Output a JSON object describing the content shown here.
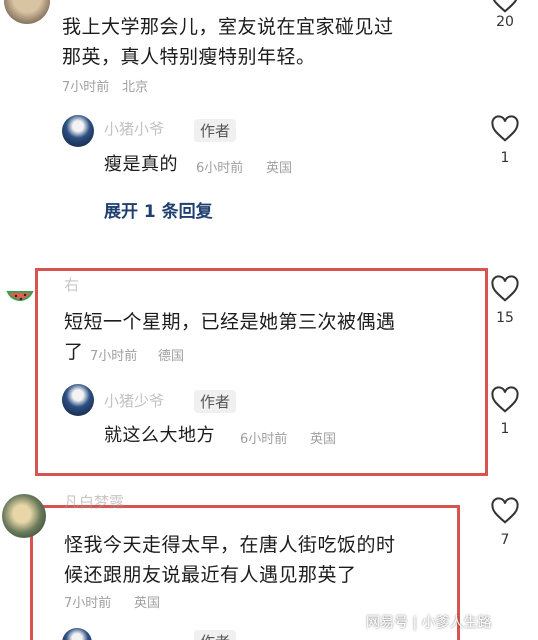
{
  "comments": [
    {
      "text_line1": "我上大学那会儿，室友说在宜家碰见过",
      "text_line2": "那英，真人特别瘦特别年轻。",
      "time": "7小时前",
      "location": "北京",
      "likes": "20",
      "reply": {
        "name": "小猪小爷",
        "badge": "作者",
        "text": "瘦是真的",
        "time": "6小时前",
        "location": "英国",
        "likes": "1"
      },
      "expand_label": "展开 1 条回复"
    },
    {
      "name": "右",
      "text_line1": "短短一个星期，已经是她第三次被偶遇",
      "text_line2": "了",
      "time": "7小时前",
      "location": "德国",
      "likes": "15",
      "reply": {
        "name": "小猪少爷",
        "badge": "作者",
        "text": "就这么大地方",
        "time": "6小时前",
        "location": "英国",
        "likes": "1"
      }
    },
    {
      "name": "凡白梦露",
      "text_line1": "怪我今天走得太早，在唐人街吃饭的时",
      "text_line2": "候还跟朋友说最近有人遇见那英了",
      "time": "7小时前",
      "location": "英国",
      "likes": "7",
      "reply": {
        "badge": "作者"
      }
    }
  ],
  "watermark": "网易号 | 小爹人生路",
  "colors": {
    "highlight_box": "#d9534f",
    "link": "#1f3f6e",
    "meta": "#a0a0a0"
  }
}
